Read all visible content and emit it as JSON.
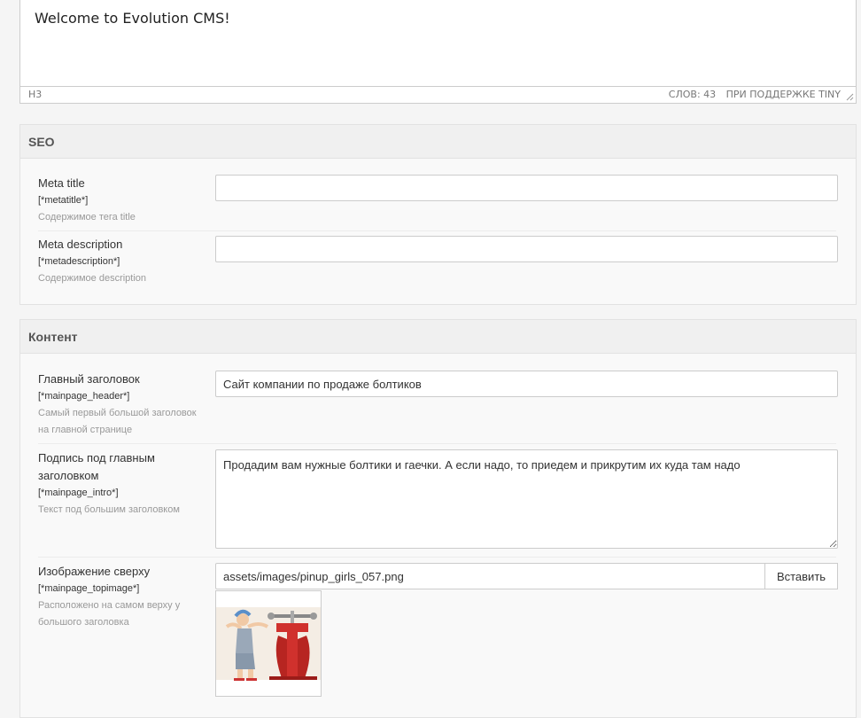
{
  "editor": {
    "content": "Welcome to Evolution CMS!",
    "path": "H3",
    "word_count": "СЛОВ: 43",
    "powered_by": "ПРИ ПОДДЕРЖКЕ TINY"
  },
  "seo": {
    "title": "SEO",
    "fields": [
      {
        "label": "Meta title",
        "var": "[*metatitle*]",
        "desc": "Содержимое тега title",
        "value": ""
      },
      {
        "label": "Meta description",
        "var": "[*metadescription*]",
        "desc": "Содержимое description",
        "value": ""
      }
    ]
  },
  "content": {
    "title": "Контент",
    "header": {
      "label": "Главный заголовок",
      "var": "[*mainpage_header*]",
      "desc1": "Самый первый большой заголовок",
      "desc2": "на главной странице",
      "value": "Сайт компании по продаже болтиков"
    },
    "intro": {
      "label1": "Подпись под главным",
      "label2": "заголовком",
      "var": "[*mainpage_intro*]",
      "desc": "Текст под большим заголовком",
      "value": "Продадим вам нужные болтики и гаечки. А если надо, то приедем и прикрутим их куда там надо"
    },
    "topimage": {
      "label": "Изображение сверху",
      "var": "[*mainpage_topimage*]",
      "desc1": "Расположено на самом верху у",
      "desc2": "большого заголовка",
      "value": "assets/images/pinup_girls_057.png",
      "button": "Вставить"
    }
  }
}
